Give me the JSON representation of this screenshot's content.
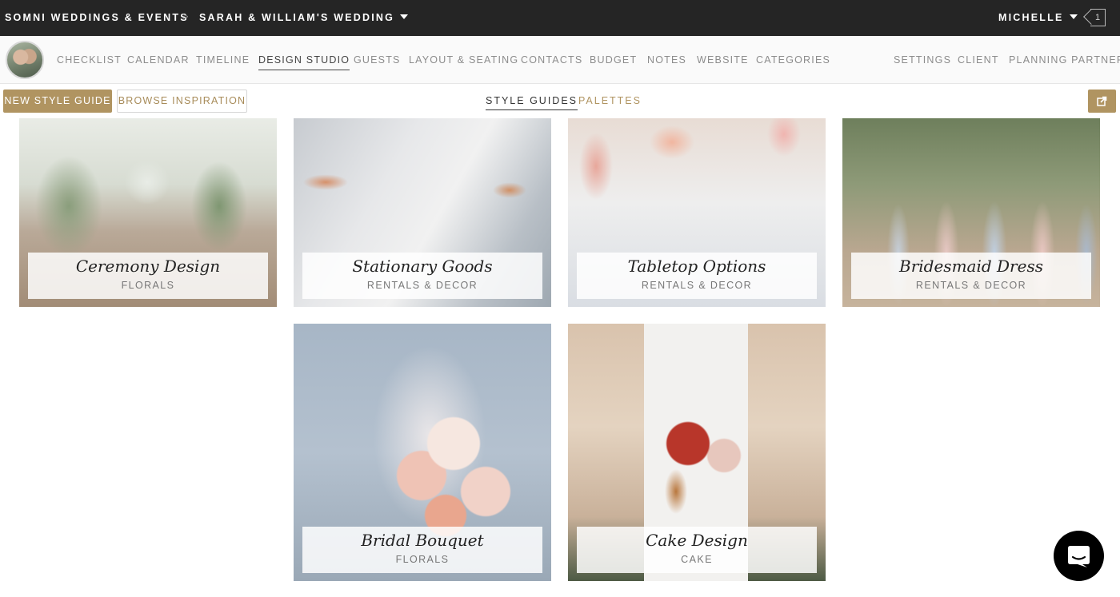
{
  "topbar": {
    "company": "SOMNI WEDDINGS & EVENTS",
    "separator": ">",
    "event": "SARAH & WILLIAM'S WEDDING",
    "user": "MICHELLE",
    "notification_count": "1"
  },
  "nav": {
    "items": [
      "CHECKLIST",
      "CALENDAR",
      "TIMELINE",
      "DESIGN STUDIO",
      "GUESTS",
      "LAYOUT & SEATING",
      "CONTACTS",
      "BUDGET",
      "NOTES",
      "WEBSITE",
      "CATEGORIES"
    ],
    "active": "DESIGN STUDIO",
    "right_items": [
      "SETTINGS",
      "CLIENT",
      "PLANNING PARTNERS"
    ]
  },
  "toolbar": {
    "new_style_guide": "NEW STYLE GUIDE",
    "browse_inspiration": "BROWSE INSPIRATION",
    "tabs": [
      "STYLE GUIDES",
      "PALETTES"
    ],
    "active_tab": "STYLE GUIDES"
  },
  "cards": [
    {
      "title": "Ceremony Design",
      "subtitle": "FLORALS"
    },
    {
      "title": "Stationary Goods",
      "subtitle": "RENTALS & DECOR"
    },
    {
      "title": "Tabletop Options",
      "subtitle": "RENTALS & DECOR"
    },
    {
      "title": "Bridesmaid Dress",
      "subtitle": "RENTALS & DECOR"
    },
    {
      "title": "Bridal Bouquet",
      "subtitle": "FLORALS"
    },
    {
      "title": "Cake Design",
      "subtitle": "CAKE"
    }
  ],
  "colors": {
    "topbar_bg": "#252525",
    "accent_gold": "#b09461",
    "chat_bubble": "#000000"
  },
  "icons": [
    "caret-down-icon",
    "notification-flag-icon",
    "share-icon",
    "chat-icon"
  ]
}
